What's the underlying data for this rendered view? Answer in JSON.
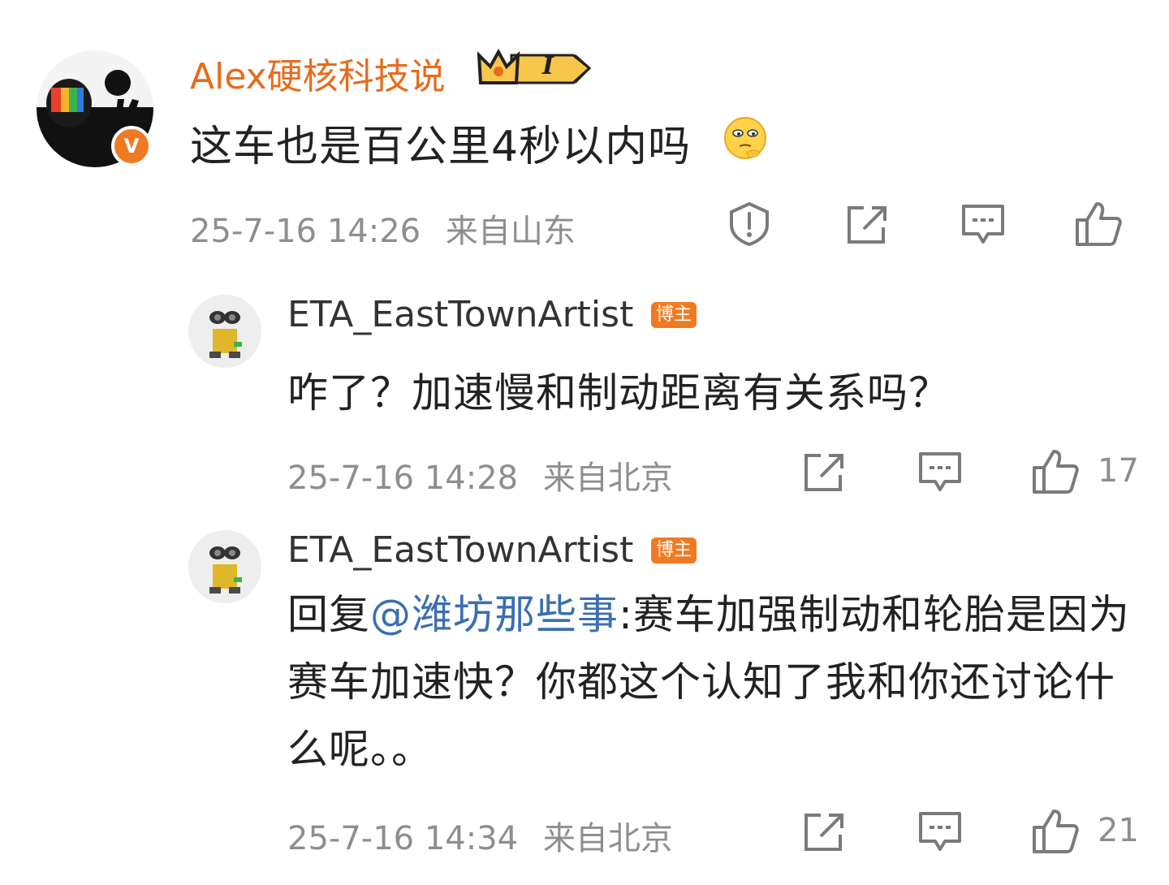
{
  "main_comment": {
    "username": "Alex硬核科技说",
    "level_badge": "I",
    "verified_mark": "V",
    "text": "这车也是百公里4秒以内吗",
    "emoji": "thinking-face",
    "timestamp": "25-7-16 14:26",
    "location": "来自山东"
  },
  "replies": [
    {
      "username": "ETA_EastTownArtist",
      "author_badge": "博主",
      "text": "咋了？加速慢和制动距离有关系吗？",
      "timestamp": "25-7-16 14:28",
      "location": "来自北京",
      "likes": "17"
    },
    {
      "username": "ETA_EastTownArtist",
      "author_badge": "博主",
      "reply_prefix": "回复",
      "mention": "@潍坊那些事",
      "text": ":赛车加强制动和轮胎是因为赛车加速快？你都这个认知了我和你还讨论什么呢。。",
      "timestamp": "25-7-16 14:34",
      "location": "来自北京",
      "likes": "21"
    }
  ],
  "colors": {
    "username_accent": "#e86b1b",
    "mention": "#3a6fb0",
    "meta_gray": "#8e8e8e",
    "badge_orange": "#f07a22"
  }
}
